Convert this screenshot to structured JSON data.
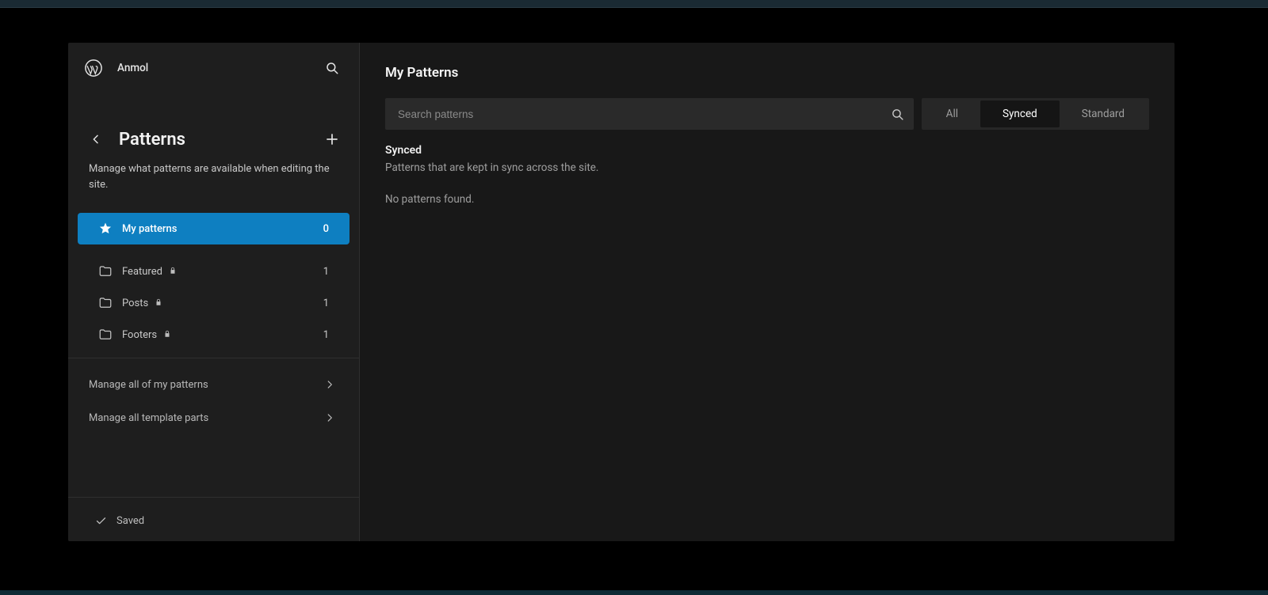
{
  "sidebar": {
    "site_name": "Anmol",
    "section_title": "Patterns",
    "section_desc": "Manage what patterns are available when editing the site.",
    "my_patterns": {
      "label": "My patterns",
      "count": "0"
    },
    "categories": [
      {
        "label": "Featured",
        "count": "1",
        "locked": true
      },
      {
        "label": "Posts",
        "count": "1",
        "locked": true
      },
      {
        "label": "Footers",
        "count": "1",
        "locked": true
      }
    ],
    "manage": [
      {
        "label": "Manage all of my patterns"
      },
      {
        "label": "Manage all template parts"
      }
    ],
    "saved_label": "Saved"
  },
  "main": {
    "title": "My Patterns",
    "search_placeholder": "Search patterns",
    "filters": {
      "all": "All",
      "synced": "Synced",
      "standard": "Standard",
      "active": "synced"
    },
    "section_heading": "Synced",
    "section_desc": "Patterns that are kept in sync across the site.",
    "empty_msg": "No patterns found."
  }
}
